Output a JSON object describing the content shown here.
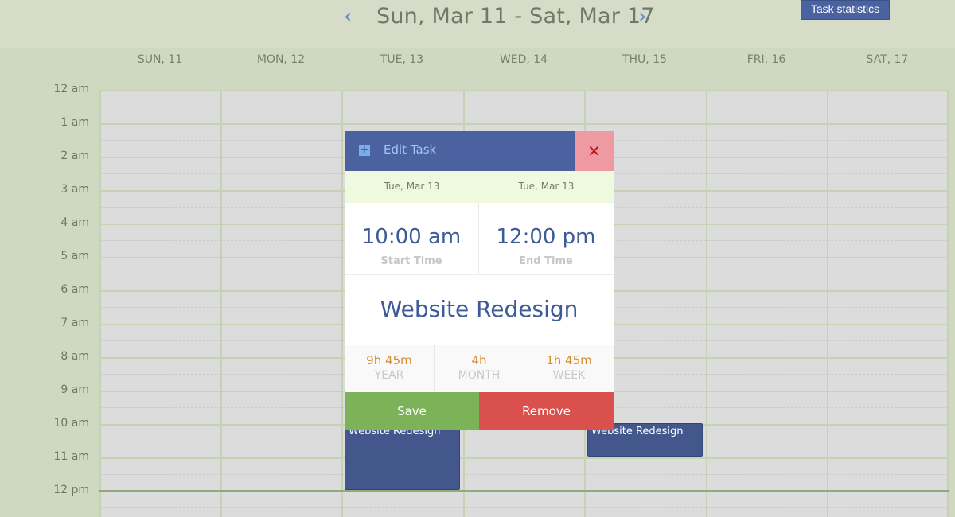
{
  "header": {
    "prev_icon": "chevron-left-icon",
    "next_icon": "chevron-right-icon",
    "prev_glyph": "‹",
    "next_glyph": "›",
    "week_title": "Sun, Mar 11 - Sat, Mar 17",
    "stats_button": "Task statistics"
  },
  "days": [
    "SUN, 11",
    "MON, 12",
    "TUE, 13",
    "WED, 14",
    "THU, 15",
    "FRI, 16",
    "SAT, 17"
  ],
  "hours": [
    "12 am",
    "1 am",
    "2 am",
    "3 am",
    "4 am",
    "5 am",
    "6 am",
    "7 am",
    "8 am",
    "9 am",
    "10 am",
    "11 am",
    "12 pm"
  ],
  "events": [
    {
      "title": "Website Redesign",
      "day": "TUE, 13",
      "start": "10:00 am",
      "end": "12:00 pm"
    },
    {
      "title": "Website Redesign",
      "day": "THU, 15",
      "start": "10:00 am",
      "end": "11:00 am"
    }
  ],
  "modal": {
    "title": "Edit Task",
    "plus_icon": "plus-square-icon",
    "plus_glyph": "+",
    "close_icon": "close-icon",
    "close_glyph": "✕",
    "start_date": "Tue, Mar 13",
    "end_date": "Tue, Mar 13",
    "start_time": "10:00 am",
    "start_caption": "Start Time",
    "end_time": "12:00 pm",
    "end_caption": "End Time",
    "task_name": "Website Redesign",
    "stats": [
      {
        "value": "9h 45m",
        "label": "YEAR"
      },
      {
        "value": "4h",
        "label": "MONTH"
      },
      {
        "value": "1h 45m",
        "label": "WEEK"
      }
    ],
    "save_label": "Save",
    "remove_label": "Remove"
  },
  "colors": {
    "accent": "#4a63a0",
    "save": "#7db358",
    "remove": "#d9504c",
    "close_bg": "#ef9aa2",
    "background": "#cfd9c2"
  }
}
